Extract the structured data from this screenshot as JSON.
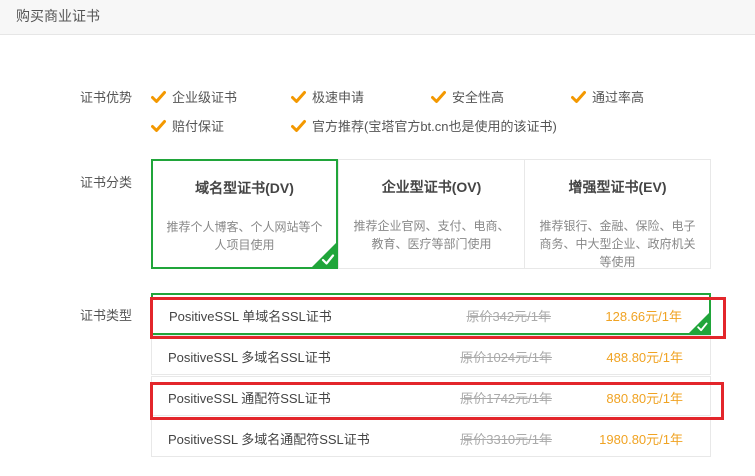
{
  "header": {
    "title": "购买商业证书"
  },
  "labels": {
    "advantages": "证书优势",
    "category": "证书分类",
    "type": "证书类型"
  },
  "advantages": [
    "企业级证书",
    "极速申请",
    "安全性高",
    "通过率高",
    "赔付保证",
    "官方推荐(宝塔官方bt.cn也是使用的该证书)"
  ],
  "categories": [
    {
      "name": "域名型证书(DV)",
      "desc": "推荐个人博客、个人网站等个人项目使用",
      "selected": true
    },
    {
      "name": "企业型证书(OV)",
      "desc": "推荐企业官网、支付、电商、教育、医疗等部门使用",
      "selected": false
    },
    {
      "name": "增强型证书(EV)",
      "desc": "推荐银行、金融、保险、电子商务、中大型企业、政府机关等使用",
      "selected": false
    }
  ],
  "products": [
    {
      "name": "PositiveSSL 单域名SSL证书",
      "original": "原价342元/1年",
      "price": "128.66元/1年",
      "selected": true
    },
    {
      "name": "PositiveSSL 多域名SSL证书",
      "original": "原价1024元/1年",
      "price": "488.80元/1年",
      "selected": false
    },
    {
      "name": "PositiveSSL 通配符SSL证书",
      "original": "原价1742元/1年",
      "price": "880.80元/1年",
      "selected": false
    },
    {
      "name": "PositiveSSL 多域名通配符SSL证书",
      "original": "原价3310元/1年",
      "price": "1980.80元/1年",
      "selected": false
    }
  ],
  "colors": {
    "accent_green": "#20a53a",
    "price_orange": "#f0a323",
    "check_orange": "#f39800",
    "highlight_red": "#e3262b"
  },
  "icons": {
    "advantage": "checkmark-icon",
    "selected_corner": "selected-corner-check-icon"
  }
}
